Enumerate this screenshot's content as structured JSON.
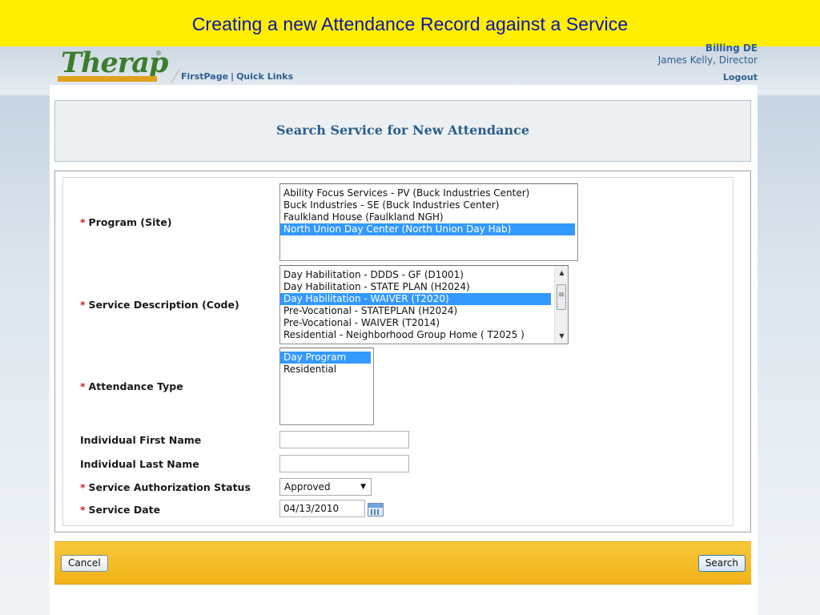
{
  "slide": {
    "title": "Creating a new Attendance  Record against a Service"
  },
  "header": {
    "logo_text": "Therap",
    "logo_reg": "®",
    "nav": {
      "first_page": "FirstPage",
      "separator": "|",
      "quick_links": "Quick Links"
    },
    "user": {
      "billing": "Billing DE",
      "name": "James Kelly, Director"
    },
    "logout": "Logout"
  },
  "search_heading": "Search Service for New Attendance",
  "form": {
    "required_mark": "*",
    "program": {
      "label": "Program (Site)",
      "options": [
        "Ability Focus Services - PV (Buck Industries Center)",
        "Buck Industries - SE (Buck Industries Center)",
        "Faulkland House (Faulkland NGH)",
        "North Union Day Center (North Union Day Hab)"
      ],
      "selected": "North Union Day Center (North Union Day Hab)"
    },
    "service": {
      "label": "Service Description (Code)",
      "options": [
        "Day Habilitation - DDDS - GF (D1001)",
        "Day Habilitation - STATE PLAN (H2024)",
        "Day Habilitation - WAIVER (T2020)",
        "Pre-Vocational - STATEPLAN (H2024)",
        "Pre-Vocational - WAIVER (T2014)",
        "Residential - Neighborhood Group Home ( T2025 )"
      ],
      "selected": "Day Habilitation - WAIVER (T2020)"
    },
    "attendance_type": {
      "label": "Attendance Type",
      "options": [
        "Day Program",
        "Residential"
      ],
      "selected": "Day Program"
    },
    "first_name": {
      "label": "Individual First Name",
      "value": ""
    },
    "last_name": {
      "label": "Individual Last Name",
      "value": ""
    },
    "auth_status": {
      "label": "Service Authorization Status",
      "value": "Approved"
    },
    "service_date": {
      "label": "Service Date",
      "value": "04/13/2010"
    }
  },
  "actions": {
    "cancel": "Cancel",
    "search": "Search"
  },
  "icons": {
    "dropdown": "chevron-down-icon",
    "calendar": "calendar-icon",
    "scroll_up": "arrow-up-icon",
    "scroll_down": "arrow-down-icon"
  },
  "colors": {
    "banner": "#ffee00",
    "title_text": "#0b16a6",
    "selection": "#3399ff",
    "action_bar": "#f1b218",
    "required": "#d42020",
    "heading": "#2c5d8a"
  }
}
